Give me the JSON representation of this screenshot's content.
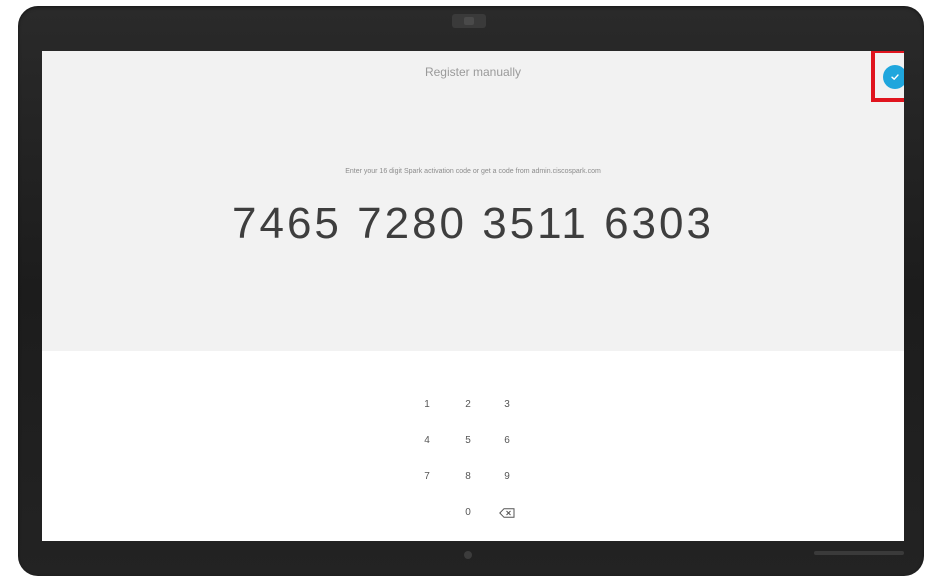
{
  "screen": {
    "header_title": "Register manually",
    "instruction": "Enter your 16 digit Spark activation code or get a code from admin.ciscospark.com",
    "activation_code": "7465 7280 3511 6303"
  },
  "confirm": {
    "icon": "checkmark-icon",
    "color": "#1fa6dd",
    "highlight_color": "#e0141e"
  },
  "keypad": {
    "keys": [
      "1",
      "2",
      "3",
      "4",
      "5",
      "6",
      "7",
      "8",
      "9",
      "0"
    ],
    "backspace_icon": "backspace-icon"
  }
}
